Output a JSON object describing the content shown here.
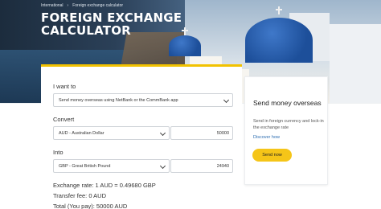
{
  "breadcrumb": {
    "items": [
      "International",
      "Foreign exchange calculator"
    ],
    "sep": "›"
  },
  "hero": {
    "title": "FOREIGN EXCHANGE CALCULATOR"
  },
  "form": {
    "want_label": "I want to",
    "want_value": "Send money overseas using NetBank or the CommBank app",
    "convert_label": "Convert",
    "from_currency": "AUD - Australian Dollar",
    "from_amount": "50000",
    "into_label": "Into",
    "to_currency": "GBP - Great British Pound",
    "to_amount": "24940"
  },
  "results": {
    "rate": "Exchange rate: 1 AUD = 0.49680 GBP",
    "fee": "Transfer fee: 0 AUD",
    "total": "Total (You pay): 50000 AUD"
  },
  "side_card": {
    "title": "Send money overseas",
    "description": "Send in foreign currency and lock-in the exchange rate",
    "link": "Discover how",
    "button": "Send now"
  },
  "colors": {
    "accent": "#f5c518",
    "link": "#2b6cb0"
  }
}
